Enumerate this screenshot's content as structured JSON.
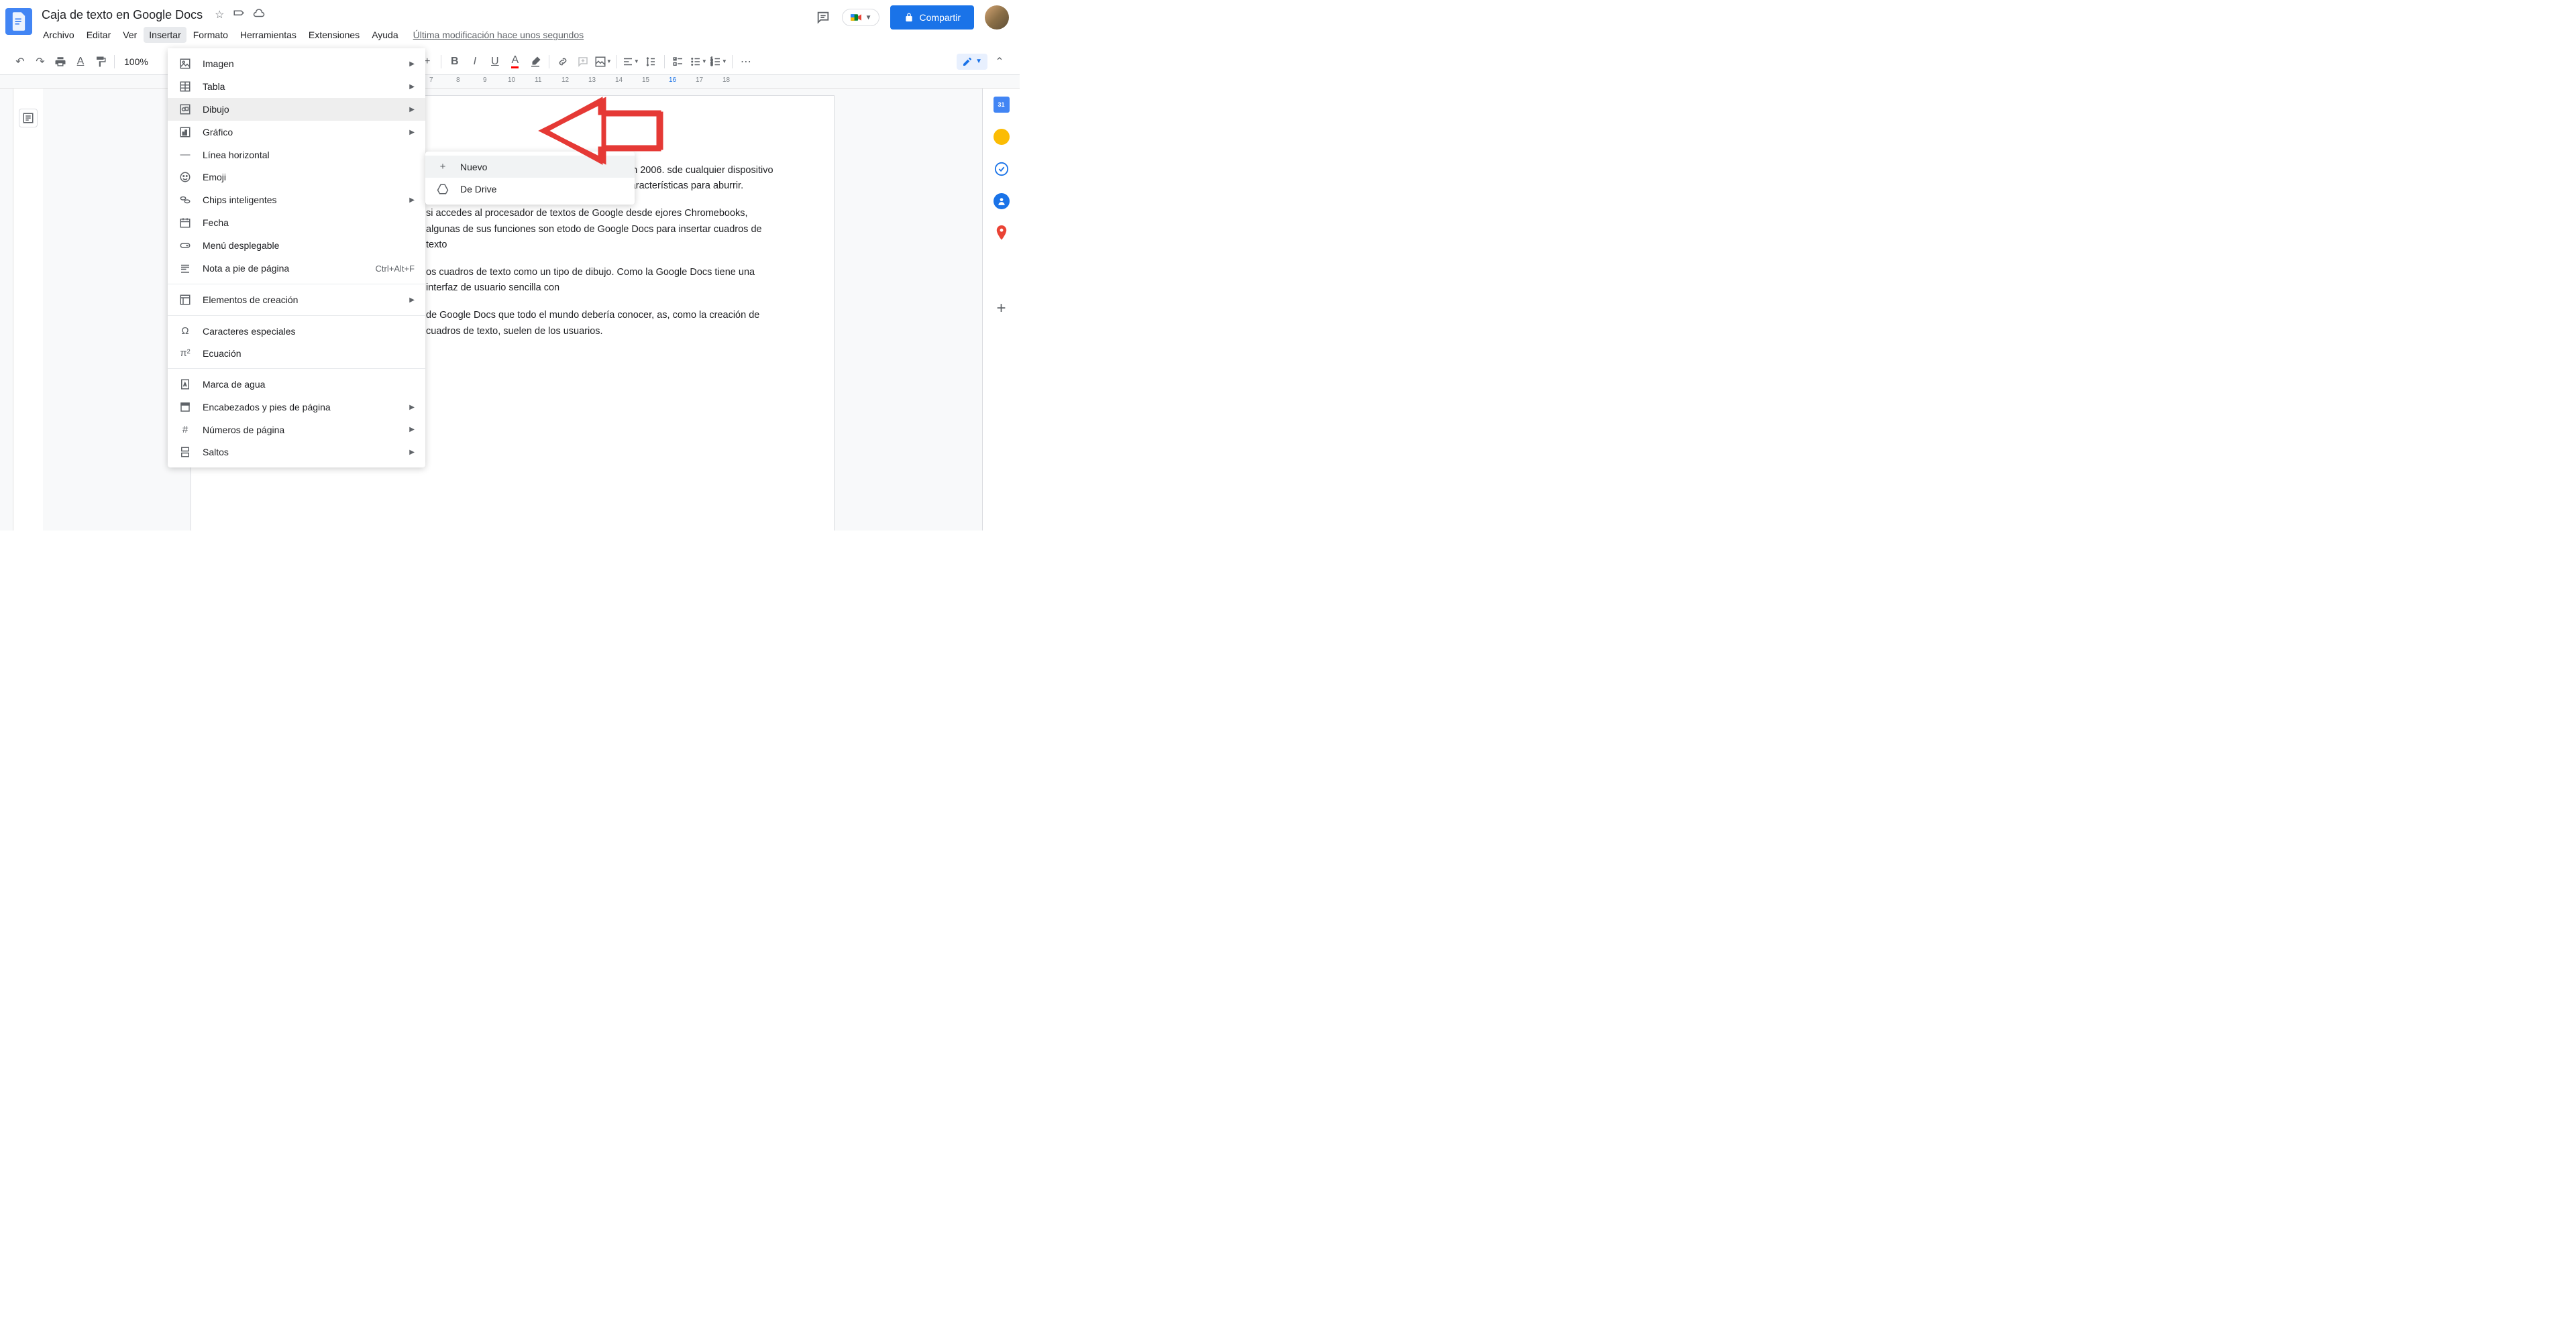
{
  "header": {
    "doc_title": "Caja de texto en Google Docs",
    "last_modification": "Última modificación hace unos segundos",
    "share_label": "Compartir"
  },
  "menubar": {
    "file": "Archivo",
    "edit": "Editar",
    "view": "Ver",
    "insert": "Insertar",
    "format": "Formato",
    "tools": "Herramientas",
    "extensions": "Extensiones",
    "help": "Ayuda"
  },
  "toolbar": {
    "zoom": "100%"
  },
  "insert_menu": {
    "image": "Imagen",
    "table": "Tabla",
    "drawing": "Dibujo",
    "chart": "Gráfico",
    "hr": "Línea horizontal",
    "emoji": "Emoji",
    "smart_chips": "Chips inteligentes",
    "date": "Fecha",
    "dropdown": "Menú desplegable",
    "footnote": "Nota a pie de página",
    "footnote_shortcut": "Ctrl+Alt+F",
    "building_blocks": "Elementos de creación",
    "special_chars": "Caracteres especiales",
    "equation": "Ecuación",
    "watermark": "Marca de agua",
    "headers_footers": "Encabezados y pies de página",
    "page_numbers": "Números de página",
    "break": "Saltos"
  },
  "submenu": {
    "new": "Nuevo",
    "from_drive": "De Drive"
  },
  "document": {
    "p1": "cs se ha hecho popular desde su lanzamiento en 2006. sde cualquier dispositivo y hace casi todo lo que se extos. Tiene tantas características para aburrir.",
    "p2": "si accedes al procesador de textos de Google desde ejores Chromebooks, algunas de sus funciones son etodo de Google Docs para insertar cuadros de texto",
    "p3": "os cuadros de texto como un tipo de dibujo. Como la Google Docs tiene una interfaz de usuario sencilla con",
    "p4": "de Google Docs que todo el mundo debería conocer, as, como la creación de cuadros de texto, suelen de los usuarios."
  },
  "ruler": {
    "marks": [
      "7",
      "8",
      "9",
      "10",
      "11",
      "12",
      "13",
      "14",
      "15",
      "16",
      "17",
      "18"
    ]
  },
  "sidebar": {
    "calendar": "31"
  }
}
